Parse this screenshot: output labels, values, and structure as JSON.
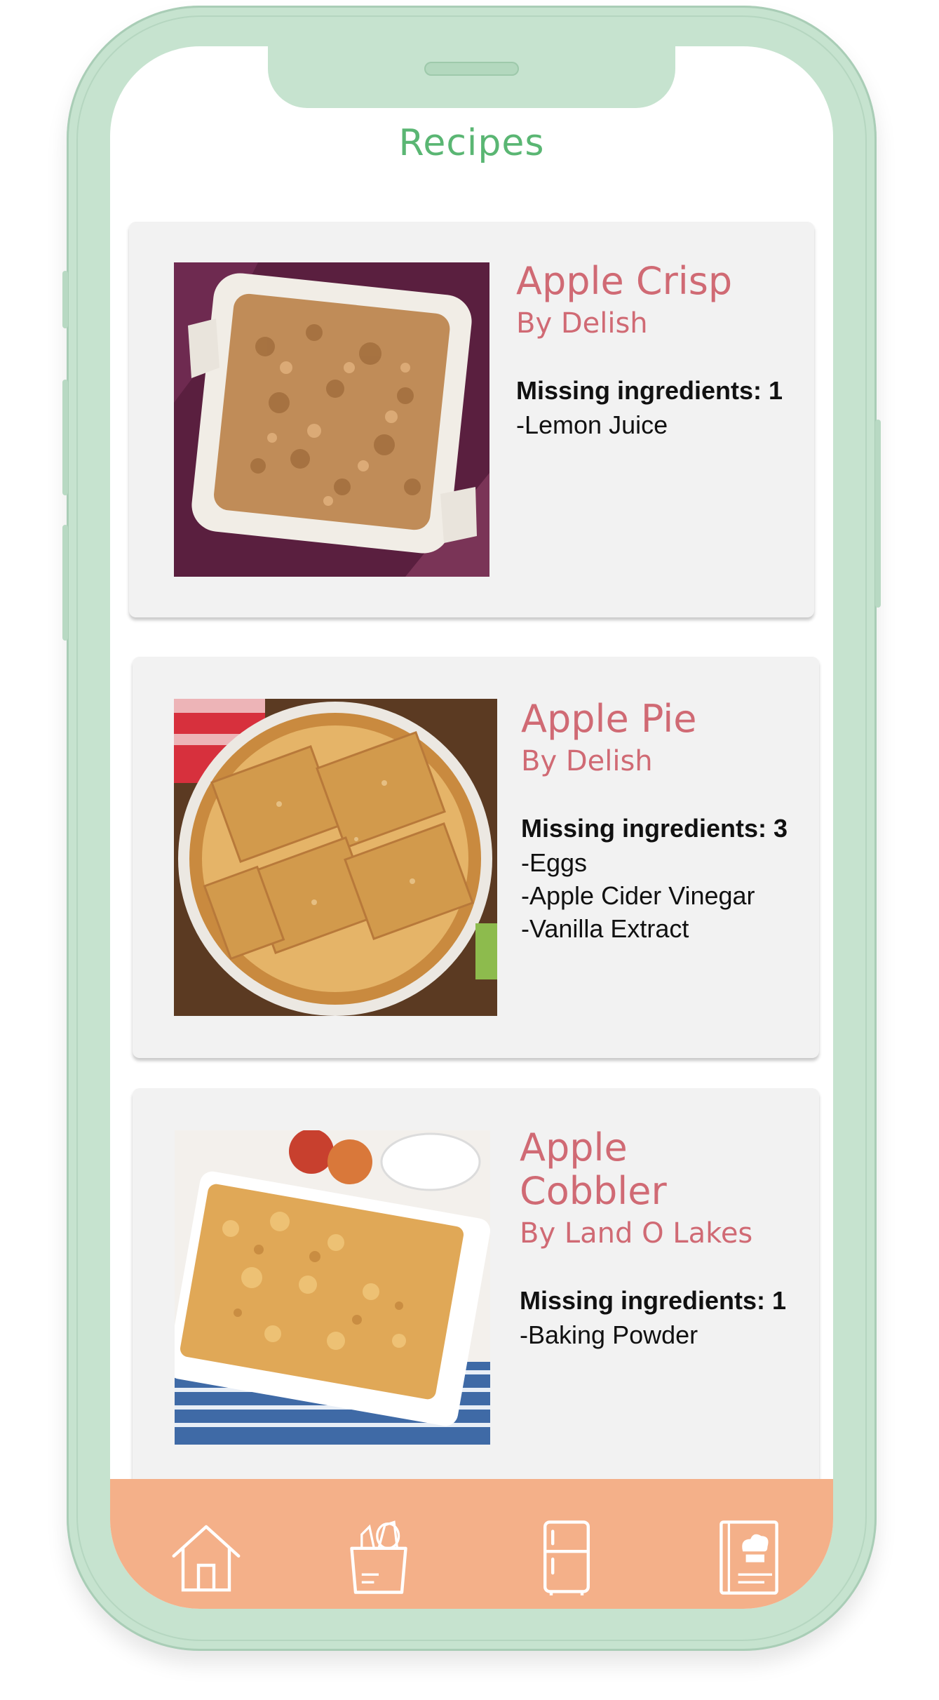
{
  "app": {
    "title": "Recipes"
  },
  "recipes": [
    {
      "title_lines": [
        "Apple Crisp"
      ],
      "author": "By Delish",
      "missing_label": "Missing ingredients: 1",
      "ingredients": [
        "-Lemon Juice"
      ],
      "image_icon": "apple-crisp-photo"
    },
    {
      "title_lines": [
        "Apple Pie"
      ],
      "author": "By Delish",
      "missing_label": "Missing ingredients: 3",
      "ingredients": [
        "-Eggs",
        "-Apple Cider Vinegar",
        "-Vanilla Extract"
      ],
      "image_icon": "apple-pie-photo"
    },
    {
      "title_lines": [
        "Apple",
        "Cobbler"
      ],
      "author": "By Land O Lakes",
      "missing_label": "Missing ingredients: 1",
      "ingredients": [
        "-Baking Powder"
      ],
      "image_icon": "apple-cobbler-photo"
    }
  ],
  "nav": {
    "items": [
      {
        "icon": "home-icon"
      },
      {
        "icon": "grocery-bag-icon"
      },
      {
        "icon": "fridge-icon"
      },
      {
        "icon": "cookbook-icon"
      }
    ]
  },
  "colors": {
    "frame": "#c6e3cf",
    "title": "#5ab673",
    "recipe_title": "#d06a74",
    "card_bg": "#f2f2f2",
    "navbar_bg": "#f4b089"
  }
}
